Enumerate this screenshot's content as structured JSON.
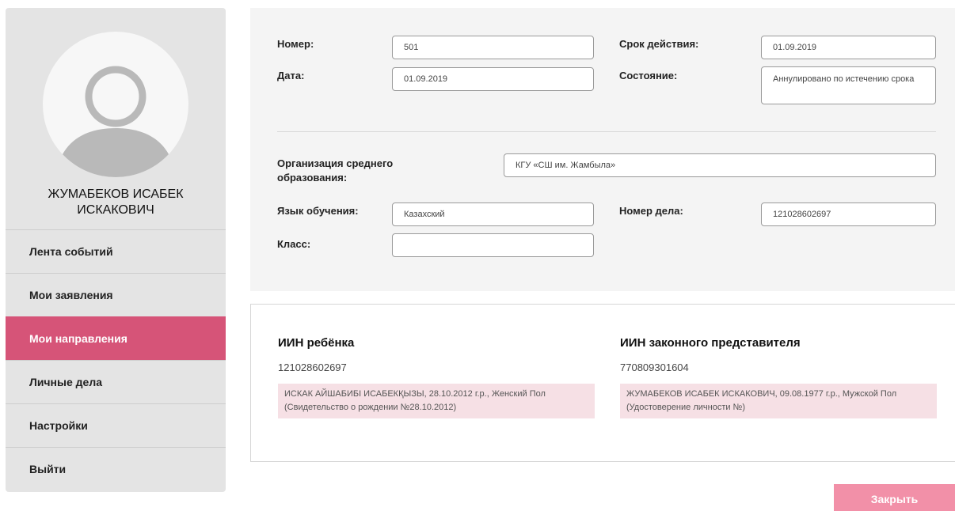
{
  "sidebar": {
    "user_name": "ЖУМАБЕКОВ ИСАБЕК ИСКАКОВИЧ",
    "avatar_icon": "user-avatar-icon",
    "active_color": "#d65478",
    "items": [
      {
        "label": "Лента событий"
      },
      {
        "label": "Мои заявления"
      },
      {
        "label": "Мои направления"
      },
      {
        "label": "Личные дела"
      },
      {
        "label": "Настройки"
      },
      {
        "label": "Выйти"
      }
    ]
  },
  "form": {
    "number_label": "Номер:",
    "number_value": "501",
    "validity_label": "Срок действия:",
    "validity_value": "01.09.2019",
    "date_label": "Дата:",
    "date_value": "01.09.2019",
    "status_label": "Состояние:",
    "status_value": "Аннулировано по истечению срока",
    "org_label": "Организация среднего образования:",
    "org_value": "КГУ «СШ им. Жамбыла»",
    "language_label": "Язык обучения:",
    "language_value": "Казахский",
    "case_label": "Номер дела:",
    "case_value": "121028602697",
    "class_label": "Класс:",
    "class_value": ""
  },
  "info": {
    "child_title": "ИИН ребёнка",
    "child_iin": "121028602697",
    "child_details": "ИСКАК АЙШАБИБІ ИСАБЕКҚЫЗЫ, 28.10.2012 г.р., Женский Пол (Свидетельство о рождении №28.10.2012)",
    "parent_title": "ИИН законного представителя",
    "parent_iin": "770809301604",
    "parent_details": "ЖУМАБЕКОВ ИСАБЕК ИСКАКОВИЧ, 09.08.1977 г.р., Мужской Пол (Удостоверение личности №)"
  },
  "actions": {
    "close_label": "Закрыть",
    "close_color": "#f290a8"
  }
}
